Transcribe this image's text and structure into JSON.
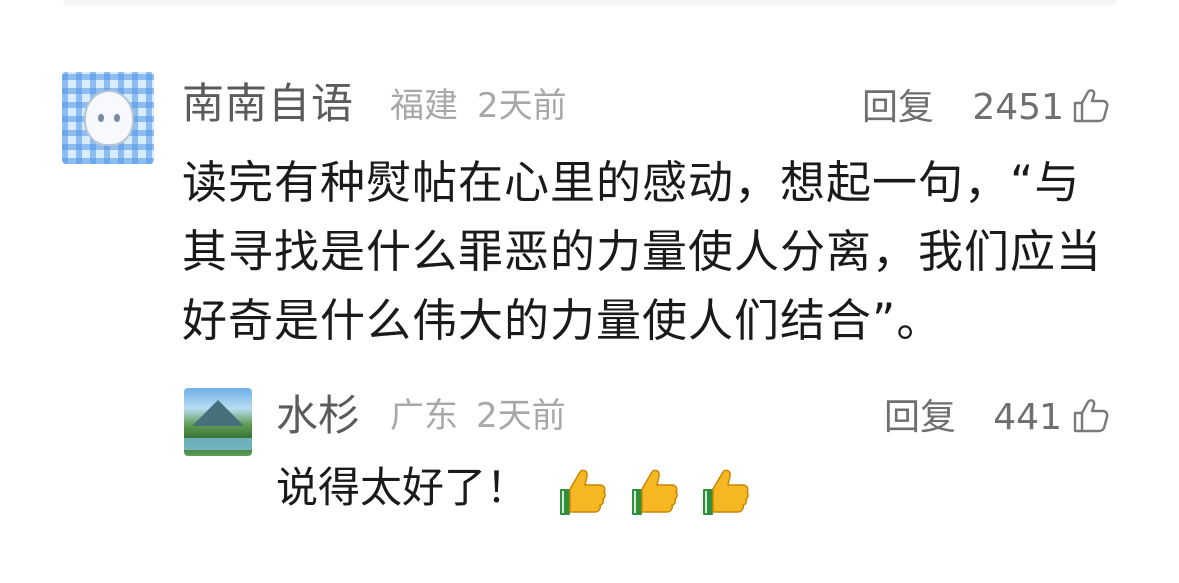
{
  "comment": {
    "username": "南南自语",
    "location": "福建",
    "time": "2天前",
    "reply_label": "回复",
    "likes": "2451",
    "text": "读完有种熨帖在心里的感动，想起一句，“与其寻找是什么罪恶的力量使人分离，我们应当好奇是什么伟大的力量使人们结合”。",
    "avatar_icon": "anime-girl-avatar-icon",
    "like_icon": "thumbs-up-outline-icon"
  },
  "sub_comment": {
    "username": "水杉",
    "location": "广东",
    "time": "2天前",
    "reply_label": "回复",
    "likes": "441",
    "text": "说得太好了！",
    "avatar_icon": "landscape-avatar-icon",
    "emojis": [
      "thumbs-up-emoji",
      "thumbs-up-emoji",
      "thumbs-up-emoji"
    ]
  },
  "colors": {
    "username": "#5b5b5b",
    "meta": "#a8a8a8",
    "text": "#1a1a1a",
    "action": "#6f6f6f"
  }
}
